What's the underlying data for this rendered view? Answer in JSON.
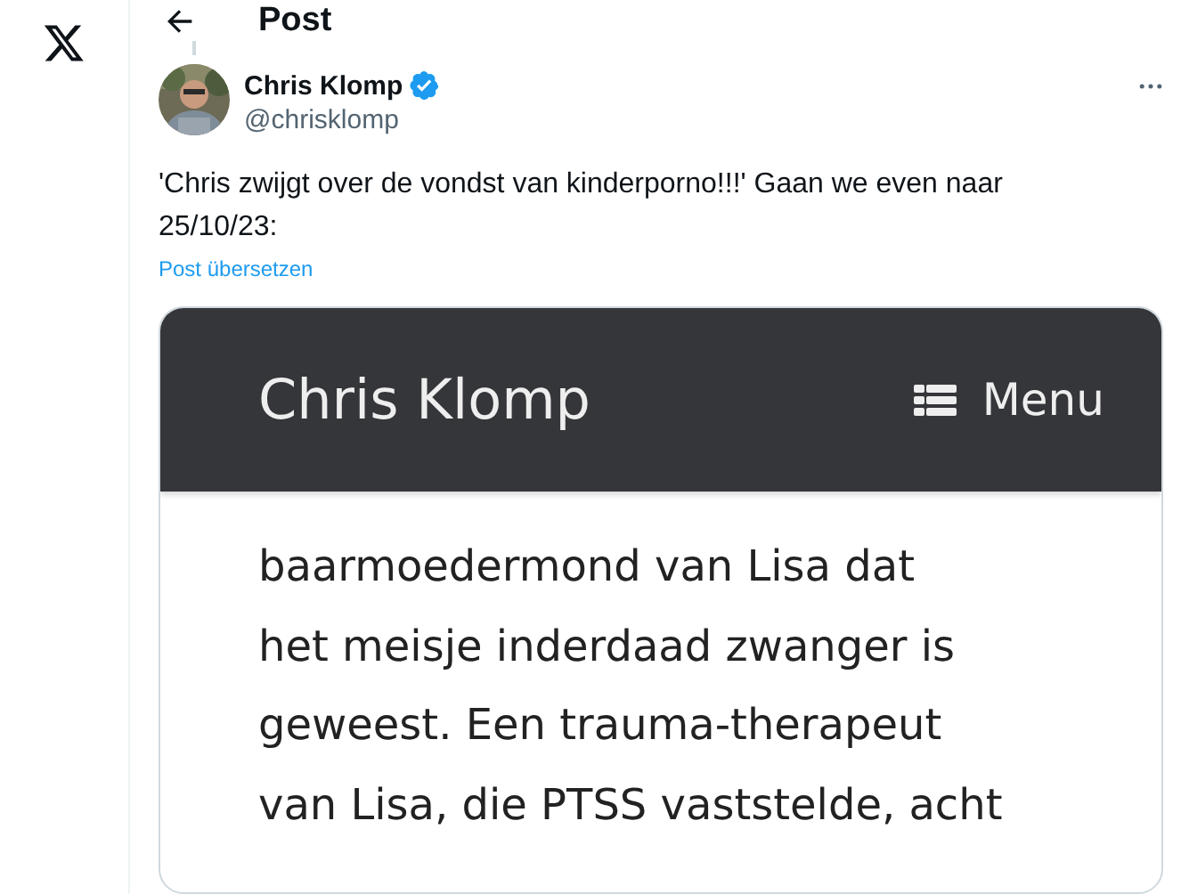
{
  "header": {
    "title": "Post"
  },
  "post": {
    "author": {
      "name": "Chris Klomp",
      "verified": true,
      "handle": "@chrisklomp"
    },
    "text": "'Chris zwijgt over de vondst van kinderporno!!!' Gaan we even naar 25/10/23:",
    "translate_link": "Post übersetzen",
    "embedded_screenshot": {
      "site_title": "Chris Klomp",
      "menu_label": "Menu",
      "lines": [
        "baarmoedermond van Lisa dat",
        "het meisje inderdaad zwanger is",
        "geweest. Een trauma-therapeut",
        "van Lisa, die PTSS vaststelde, acht"
      ]
    }
  }
}
